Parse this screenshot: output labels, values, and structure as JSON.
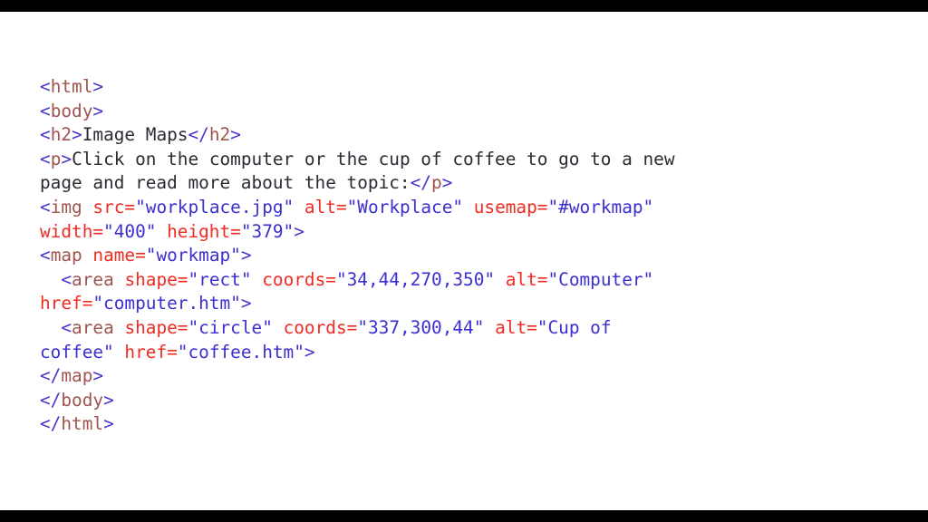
{
  "window": {
    "title": "HTML Image Maps Code Snippet",
    "background_color": "#ffffff",
    "letterbox_color": "#000000"
  },
  "theme": {
    "bracket_color": "#4734c9",
    "tag_name_color": "#9e544f",
    "attribute_name_color": "#f02b22",
    "attribute_value_color": "#3b2fd0",
    "text_color": "#2b2b33"
  },
  "code": {
    "language": "html",
    "full_text": "<html>\n<body>\n<h2>Image Maps</h2>\n<p>Click on the computer or the cup of coffee to go to a new page and read more about the topic:</p>\n<img src=\"workplace.jpg\" alt=\"Workplace\" usemap=\"#workmap\" width=\"400\" height=\"379\">\n<map name=\"workmap\">\n  <area shape=\"rect\" coords=\"34,44,270,350\" alt=\"Computer\" href=\"computer.htm\">\n  <area shape=\"circle\" coords=\"337,300,44\" alt=\"Cup of coffee\" href=\"coffee.htm\">\n</map>\n</body>\n</html>",
    "lines": [
      {
        "id": "line-html-open",
        "tokens": [
          {
            "t": "brk",
            "s": "<"
          },
          {
            "t": "tag",
            "s": "html"
          },
          {
            "t": "brk",
            "s": ">"
          }
        ]
      },
      {
        "id": "line-body-open",
        "tokens": [
          {
            "t": "brk",
            "s": "<"
          },
          {
            "t": "tag",
            "s": "body"
          },
          {
            "t": "brk",
            "s": ">"
          }
        ]
      },
      {
        "id": "line-h2",
        "tokens": [
          {
            "t": "brk",
            "s": "<"
          },
          {
            "t": "tag",
            "s": "h2"
          },
          {
            "t": "brk",
            "s": ">"
          },
          {
            "t": "txt",
            "s": "Image Maps"
          },
          {
            "t": "brk",
            "s": "</"
          },
          {
            "t": "tag",
            "s": "h2"
          },
          {
            "t": "brk",
            "s": ">"
          }
        ]
      },
      {
        "id": "line-paragraph",
        "tokens": [
          {
            "t": "brk",
            "s": "<"
          },
          {
            "t": "tag",
            "s": "p"
          },
          {
            "t": "brk",
            "s": ">"
          },
          {
            "t": "txt",
            "s": "Click on the computer or the cup of coffee to go to a new page and read more about the topic:"
          },
          {
            "t": "brk",
            "s": "</"
          },
          {
            "t": "tag",
            "s": "p"
          },
          {
            "t": "brk",
            "s": ">"
          }
        ]
      },
      {
        "id": "line-img",
        "tokens": [
          {
            "t": "brk",
            "s": "<"
          },
          {
            "t": "tag",
            "s": "img"
          },
          {
            "t": "txt",
            "s": " "
          },
          {
            "t": "attr",
            "s": "src="
          },
          {
            "t": "val",
            "s": "\"workplace.jpg\""
          },
          {
            "t": "txt",
            "s": " "
          },
          {
            "t": "attr",
            "s": "alt="
          },
          {
            "t": "val",
            "s": "\"Workplace\""
          },
          {
            "t": "txt",
            "s": " "
          },
          {
            "t": "attr",
            "s": "usemap="
          },
          {
            "t": "val",
            "s": "\"#workmap\""
          },
          {
            "t": "txt",
            "s": " "
          },
          {
            "t": "attr",
            "s": "width="
          },
          {
            "t": "val",
            "s": "\"400\""
          },
          {
            "t": "txt",
            "s": " "
          },
          {
            "t": "attr",
            "s": "height="
          },
          {
            "t": "val",
            "s": "\"379\""
          },
          {
            "t": "brk",
            "s": ">"
          }
        ]
      },
      {
        "id": "line-map-open",
        "tokens": [
          {
            "t": "brk",
            "s": "<"
          },
          {
            "t": "tag",
            "s": "map"
          },
          {
            "t": "txt",
            "s": " "
          },
          {
            "t": "attr",
            "s": "name="
          },
          {
            "t": "val",
            "s": "\"workmap\""
          },
          {
            "t": "brk",
            "s": ">"
          }
        ]
      },
      {
        "id": "line-area-rect",
        "tokens": [
          {
            "t": "txt",
            "s": "  "
          },
          {
            "t": "brk",
            "s": "<"
          },
          {
            "t": "tag",
            "s": "area"
          },
          {
            "t": "txt",
            "s": " "
          },
          {
            "t": "attr",
            "s": "shape="
          },
          {
            "t": "val",
            "s": "\"rect\""
          },
          {
            "t": "txt",
            "s": " "
          },
          {
            "t": "attr",
            "s": "coords="
          },
          {
            "t": "val",
            "s": "\"34,44,270,350\""
          },
          {
            "t": "txt",
            "s": " "
          },
          {
            "t": "attr",
            "s": "alt="
          },
          {
            "t": "val",
            "s": "\"Computer\""
          },
          {
            "t": "txt",
            "s": " "
          },
          {
            "t": "attr",
            "s": "href="
          },
          {
            "t": "val",
            "s": "\"computer.htm\""
          },
          {
            "t": "brk",
            "s": ">"
          }
        ]
      },
      {
        "id": "line-area-circle",
        "tokens": [
          {
            "t": "txt",
            "s": "  "
          },
          {
            "t": "brk",
            "s": "<"
          },
          {
            "t": "tag",
            "s": "area"
          },
          {
            "t": "txt",
            "s": " "
          },
          {
            "t": "attr",
            "s": "shape="
          },
          {
            "t": "val",
            "s": "\"circle\""
          },
          {
            "t": "txt",
            "s": " "
          },
          {
            "t": "attr",
            "s": "coords="
          },
          {
            "t": "val",
            "s": "\"337,300,44\""
          },
          {
            "t": "txt",
            "s": " "
          },
          {
            "t": "attr",
            "s": "alt="
          },
          {
            "t": "val",
            "s": "\"Cup of coffee\""
          },
          {
            "t": "txt",
            "s": " "
          },
          {
            "t": "attr",
            "s": "href="
          },
          {
            "t": "val",
            "s": "\"coffee.htm\""
          },
          {
            "t": "brk",
            "s": ">"
          }
        ]
      },
      {
        "id": "line-map-close",
        "tokens": [
          {
            "t": "brk",
            "s": "</"
          },
          {
            "t": "tag",
            "s": "map"
          },
          {
            "t": "brk",
            "s": ">"
          }
        ]
      },
      {
        "id": "line-body-close",
        "tokens": [
          {
            "t": "brk",
            "s": "</"
          },
          {
            "t": "tag",
            "s": "body"
          },
          {
            "t": "brk",
            "s": ">"
          }
        ]
      },
      {
        "id": "line-html-close",
        "tokens": [
          {
            "t": "brk",
            "s": "</"
          },
          {
            "t": "tag",
            "s": "html"
          },
          {
            "t": "brk",
            "s": ">"
          }
        ]
      }
    ]
  }
}
